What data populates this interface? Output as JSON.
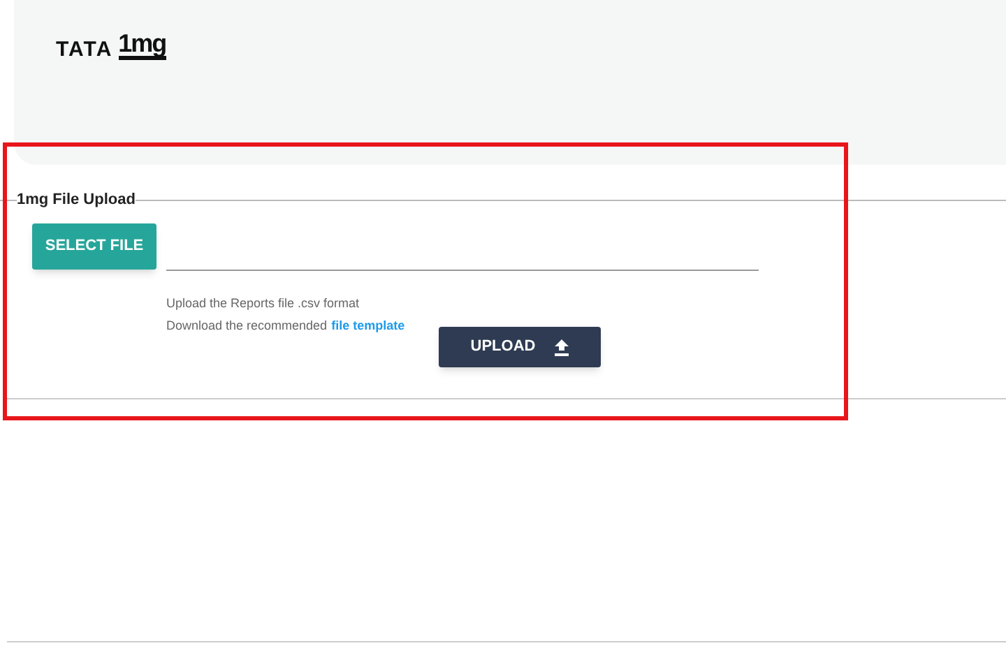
{
  "header": {
    "logo": {
      "brand": "TATA",
      "product": "1mg"
    }
  },
  "upload_section": {
    "legend": "1mg File Upload",
    "select_button": "SELECT FILE",
    "hint": "Upload the Reports file .csv format",
    "template_text": "Download the recommended",
    "template_link": "file template",
    "upload_button": "UPLOAD"
  }
}
